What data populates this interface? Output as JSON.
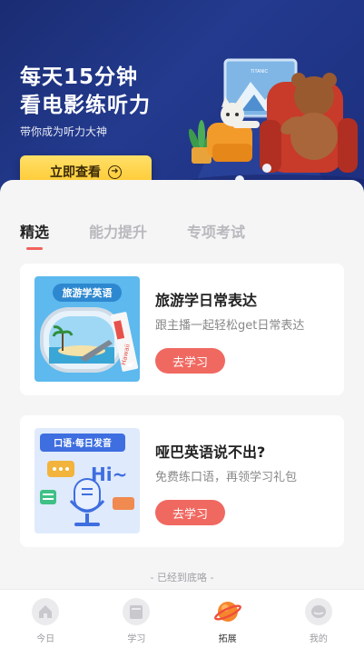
{
  "banner": {
    "title_line1": "每天15分钟",
    "title_line2": "看电影练听力",
    "subtitle": "带你成为听力大神",
    "cta_label": "立即查看",
    "cta_icon": "arrow-right-circle-icon",
    "illustration": "cartoon-animals-watching-movie"
  },
  "tabs": [
    {
      "label": "精选",
      "active": true
    },
    {
      "label": "能力提升",
      "active": false
    },
    {
      "label": "专项考试",
      "active": false
    }
  ],
  "cards": [
    {
      "title": "旅游学日常表达",
      "description": "跟主播一起轻松get日常表达",
      "button": "去学习",
      "thumb_title": "旅游学英语",
      "thumb_tag": "Hawaii"
    },
    {
      "title": "哑巴英语说不出?",
      "description": "免费练口语，再领学习礼包",
      "button": "去学习",
      "thumb_title": "口语·每日发音",
      "thumb_word": "Hi~"
    }
  ],
  "end_text": "-  已经到底咯  -",
  "nav": [
    {
      "label": "今日",
      "icon": "home-icon",
      "active": false
    },
    {
      "label": "学习",
      "icon": "book-icon",
      "active": false
    },
    {
      "label": "拓展",
      "icon": "planet-icon",
      "active": true
    },
    {
      "label": "我的",
      "icon": "profile-icon",
      "active": false
    }
  ],
  "colors": {
    "banner_bg": "#1f3384",
    "cta_yellow": "#ffcf3a",
    "accent_red": "#f06961",
    "tab_underline": "#f0625b"
  }
}
